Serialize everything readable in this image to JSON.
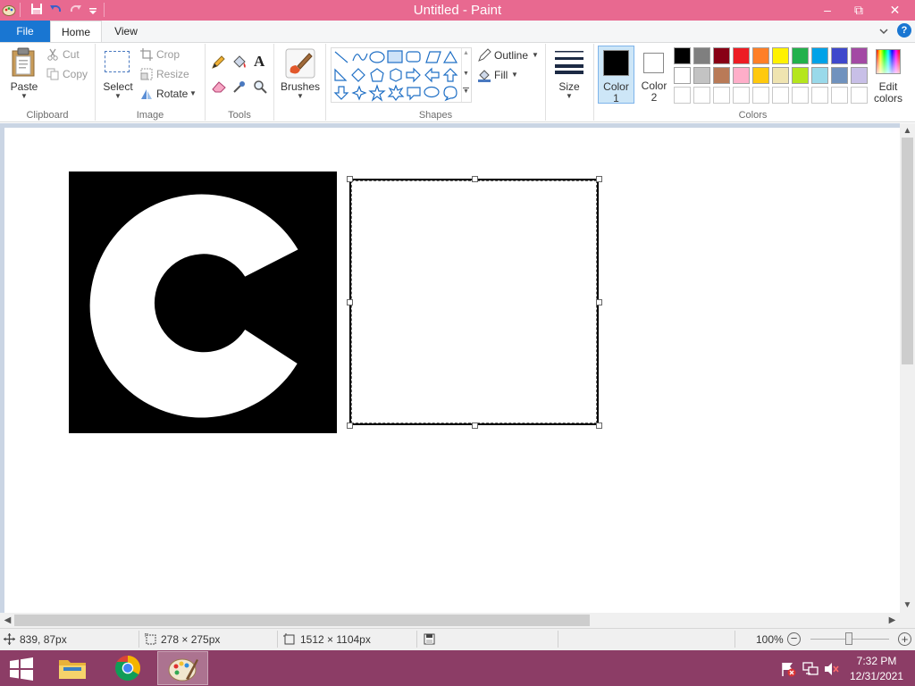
{
  "window": {
    "title": "Untitled - Paint",
    "minimize": "–",
    "maximize": "⧉",
    "close": "✕"
  },
  "tabs": {
    "file": "File",
    "home": "Home",
    "view": "View"
  },
  "ribbon": {
    "clipboard": {
      "label": "Clipboard",
      "paste": "Paste",
      "cut": "Cut",
      "copy": "Copy"
    },
    "image": {
      "label": "Image",
      "select": "Select",
      "crop": "Crop",
      "resize": "Resize",
      "rotate": "Rotate"
    },
    "tools": {
      "label": "Tools"
    },
    "brushes": {
      "label": "Brushes"
    },
    "shapes": {
      "label": "Shapes",
      "outline": "Outline",
      "fill": "Fill"
    },
    "size": {
      "label": "Size"
    },
    "colors": {
      "label": "Colors",
      "color1_line1": "Color",
      "color1_line2": "1",
      "color2_line1": "Color",
      "color2_line2": "2",
      "edit_line1": "Edit",
      "edit_line2": "colors",
      "color1_value": "#000000",
      "color2_value": "#ffffff",
      "row1": [
        "#000000",
        "#7f7f7f",
        "#880015",
        "#ed1c24",
        "#ff7f27",
        "#fff200",
        "#22b14c",
        "#00a2e8",
        "#3f48cc",
        "#a349a4"
      ],
      "row2": [
        "#ffffff",
        "#c3c3c3",
        "#b97a57",
        "#ffaec9",
        "#ffc90e",
        "#efe4b0",
        "#b5e61d",
        "#99d9ea",
        "#7092be",
        "#c8bfe7"
      ],
      "row3": [
        "#ffffff",
        "#ffffff",
        "#ffffff",
        "#ffffff",
        "#ffffff",
        "#ffffff",
        "#ffffff",
        "#ffffff",
        "#ffffff",
        "#ffffff"
      ]
    }
  },
  "status": {
    "cursor_pos": "839, 87px",
    "selection_size": "278 × 275px",
    "image_size": "1512 × 1104px",
    "zoom": "100%"
  },
  "taskbar": {
    "time": "7:32 PM",
    "date": "12/31/2021"
  },
  "canvas": {
    "logo_letter": "C"
  }
}
